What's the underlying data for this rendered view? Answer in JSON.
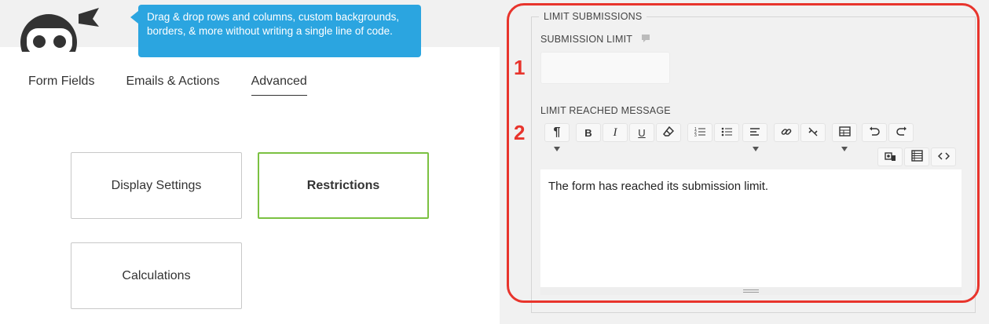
{
  "tooltip": {
    "text": "Drag & drop rows and columns, custom backgrounds, borders, & more without writing a single line of code."
  },
  "tabs": [
    {
      "label": "Form Fields",
      "active": false
    },
    {
      "label": "Emails & Actions",
      "active": false
    },
    {
      "label": "Advanced",
      "active": true
    }
  ],
  "settings": {
    "display_settings": "Display Settings",
    "restrictions": "Restrictions",
    "calculations": "Calculations"
  },
  "panel": {
    "legend": "LIMIT SUBMISSIONS",
    "submission_limit_label": "SUBMISSION LIMIT",
    "submission_limit_value": "",
    "limit_message_label": "LIMIT REACHED MESSAGE",
    "editor_text": "The form has reached its submission limit.",
    "annotation_1": "1",
    "annotation_2": "2"
  },
  "toolbar": {
    "paragraph_icon": "paragraph-icon",
    "bold_icon": "bold-icon",
    "italic_icon": "italic-icon",
    "underline_icon": "underline-icon",
    "eraser_icon": "eraser-icon",
    "ordered_list_icon": "ordered-list-icon",
    "unordered_list_icon": "unordered-list-icon",
    "align_icon": "align-left-icon",
    "link_icon": "link-icon",
    "unlink_icon": "unlink-icon",
    "table_icon": "table-icon",
    "undo_icon": "undo-icon",
    "redo_icon": "redo-icon",
    "media_icon": "media-icon",
    "merge_tags_icon": "merge-tags-icon",
    "code_icon": "code-icon"
  },
  "colors": {
    "tooltip_bg": "#2ba5e0",
    "active_border": "#7bc142",
    "highlight": "#e8342c"
  }
}
